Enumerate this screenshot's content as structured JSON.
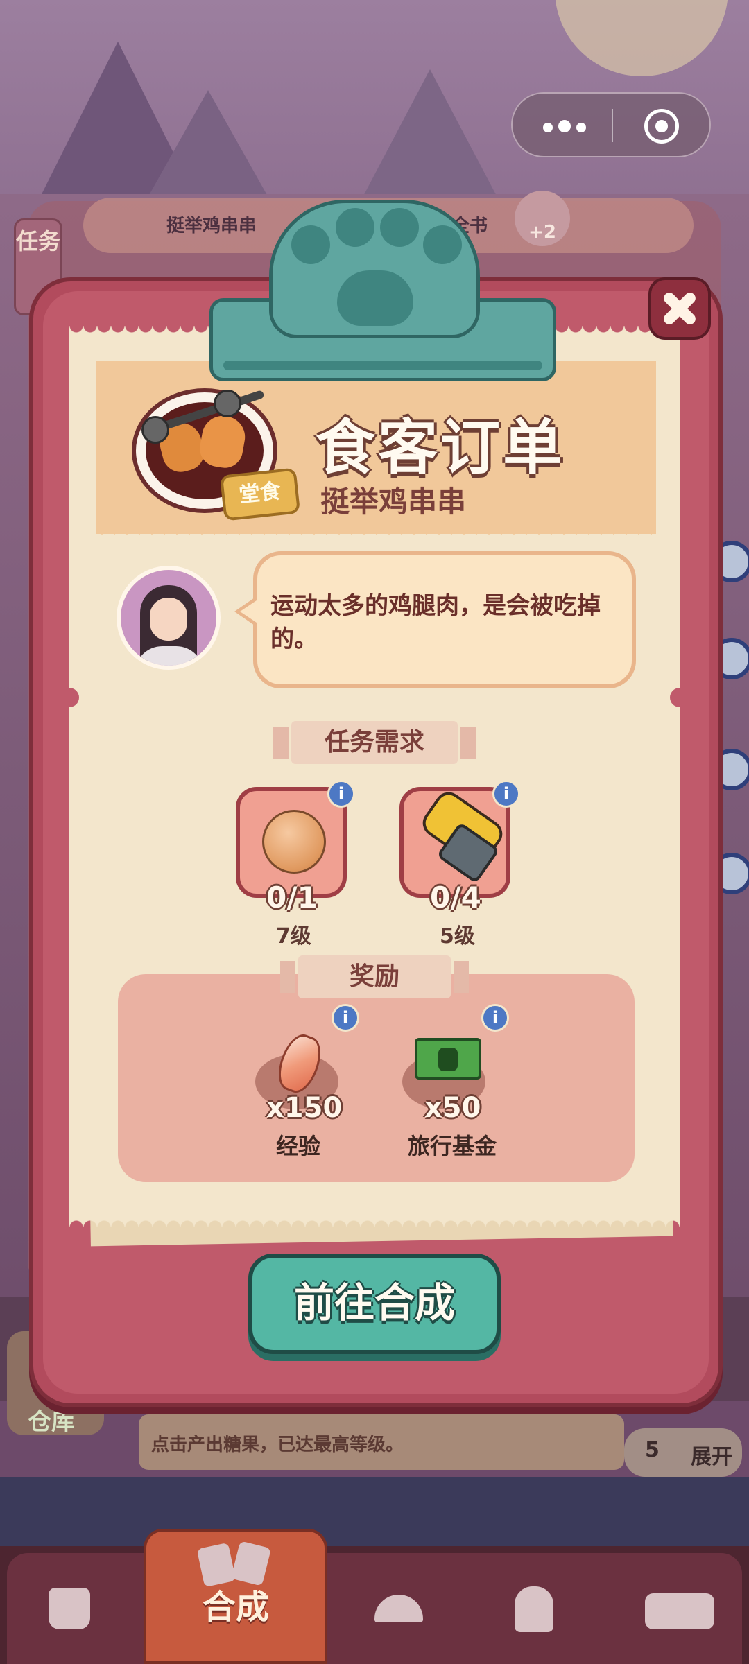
{
  "capsule_menu": {
    "more_icon": "more-dots-icon",
    "close_icon": "target-circle-icon"
  },
  "background": {
    "task_tab_label": "任务",
    "topbar_order_name": "挺举鸡串串",
    "topbar_book_label": "科全书",
    "bonus_badge": "+2",
    "store_label": "仓库",
    "tip_text": "点击产出糖果，已达最高等级。",
    "expand_count": "5",
    "expand_label": "展开"
  },
  "modal": {
    "title": "食客订单",
    "dish_name": "挺举鸡串串",
    "dish_badge": "堂食",
    "customer_quote": "运动太多的鸡腿肉，是会被吃掉的。",
    "requirements_heading": "任务需求",
    "requirements": [
      {
        "icon": "meatball-icon",
        "progress": "0/1",
        "level": "7级"
      },
      {
        "icon": "clamp-tool-icon",
        "progress": "0/4",
        "level": "5级"
      }
    ],
    "rewards_heading": "奖励",
    "rewards": [
      {
        "icon": "crystal-gem-icon",
        "amount": "x150",
        "label": "经验"
      },
      {
        "icon": "cash-stack-icon",
        "amount": "x50",
        "label": "旅行基金"
      }
    ],
    "go_button_label": "前往合成",
    "info_glyph": "i"
  },
  "bottom_nav": {
    "active_label": "合成",
    "items": [
      "shopping-bag-icon",
      "merge-cards-icon",
      "cloche-icon",
      "chef-portrait-icon",
      "bus-icon"
    ]
  },
  "colors": {
    "modal_frame": "#b24b5d",
    "paper": "#f3e6cc",
    "button_teal": "#54b7a4",
    "nav_active": "#c75a3e"
  }
}
